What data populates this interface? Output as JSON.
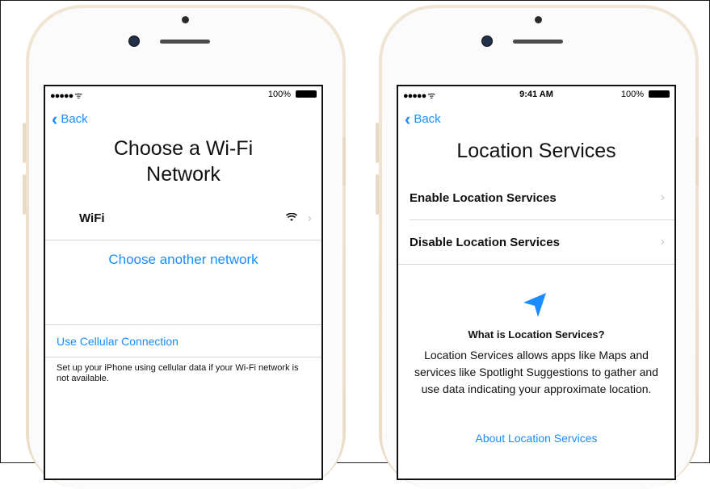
{
  "left_phone": {
    "status": {
      "signal": "●●●●● ᯤ",
      "battery": "100%"
    },
    "back_label": "Back",
    "title_line1": "Choose a Wi-Fi",
    "title_line2": "Network",
    "network_name": "WiFi",
    "choose_another": "Choose another network",
    "use_cellular": "Use Cellular Connection",
    "cellular_description": "Set up your iPhone using cellular data if your Wi-Fi network is not available."
  },
  "right_phone": {
    "status": {
      "signal": "●●●●● ᯤ",
      "time": "9:41 AM",
      "battery": "100%"
    },
    "back_label": "Back",
    "title": "Location Services",
    "enable_label": "Enable Location Services",
    "disable_label": "Disable Location Services",
    "info_heading": "What is Location Services?",
    "info_body": "Location Services allows apps like Maps and services like Spotlight Suggestions to gather and use data indicating your approximate location.",
    "about_link": "About Location Services"
  },
  "colors": {
    "accent": "#1a8cff",
    "phone_gold": "#eadcc6",
    "separator": "#d8d8d8"
  },
  "icons": [
    "back-chevron-icon",
    "wifi-icon",
    "chevron-right-icon",
    "location-arrow-icon",
    "battery-icon",
    "signal-icon"
  ]
}
